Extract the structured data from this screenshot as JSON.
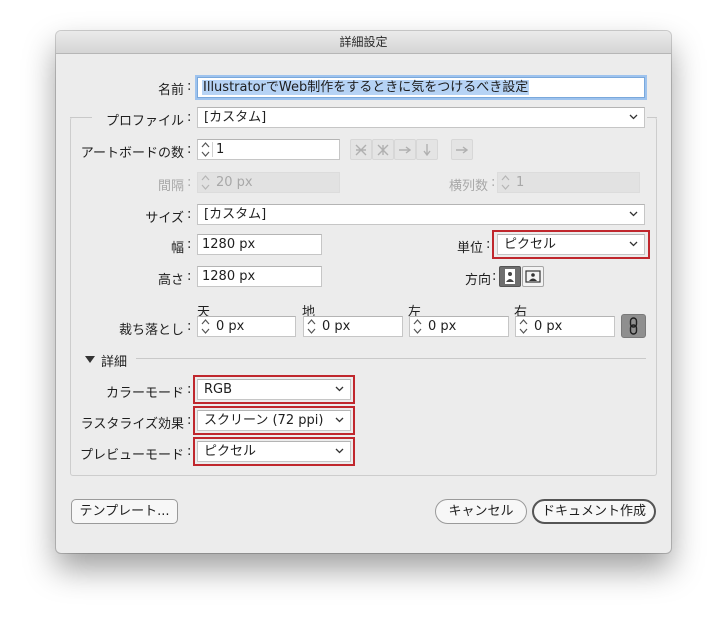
{
  "window": {
    "title": "詳細設定"
  },
  "name": {
    "label": "名前",
    "value": "IllustratorでWeb制作をするときに気をつけるべき設定"
  },
  "profile": {
    "label": "プロファイル",
    "value": "[カスタム]"
  },
  "artboards": {
    "count_label": "アートボードの数",
    "count_value": "1",
    "spacing_label": "間隔",
    "spacing_value": "20 px",
    "columns_label": "横列数",
    "columns_value": "1"
  },
  "size": {
    "label": "サイズ",
    "value": "[カスタム]"
  },
  "width": {
    "label": "幅",
    "value": "1280 px"
  },
  "height": {
    "label": "高さ",
    "value": "1280 px"
  },
  "units": {
    "label": "単位",
    "value": "ピクセル"
  },
  "orientation": {
    "label": "方向"
  },
  "bleed": {
    "label": "裁ち落とし",
    "top_label": "天",
    "top_value": "0 px",
    "bottom_label": "地",
    "bottom_value": "0 px",
    "left_label": "左",
    "left_value": "0 px",
    "right_label": "右",
    "right_value": "0 px"
  },
  "advanced": {
    "label": "詳細",
    "color_mode_label": "カラーモード",
    "color_mode_value": "RGB",
    "raster_label": "ラスタライズ効果",
    "raster_value": "スクリーン (72 ppi)",
    "preview_label": "プレビューモード",
    "preview_value": "ピクセル"
  },
  "buttons": {
    "template": "テンプレート...",
    "cancel": "キャンセル",
    "create": "ドキュメント作成"
  },
  "colors": {
    "highlight": "#c0272d",
    "focus": "#9ec3ee"
  }
}
